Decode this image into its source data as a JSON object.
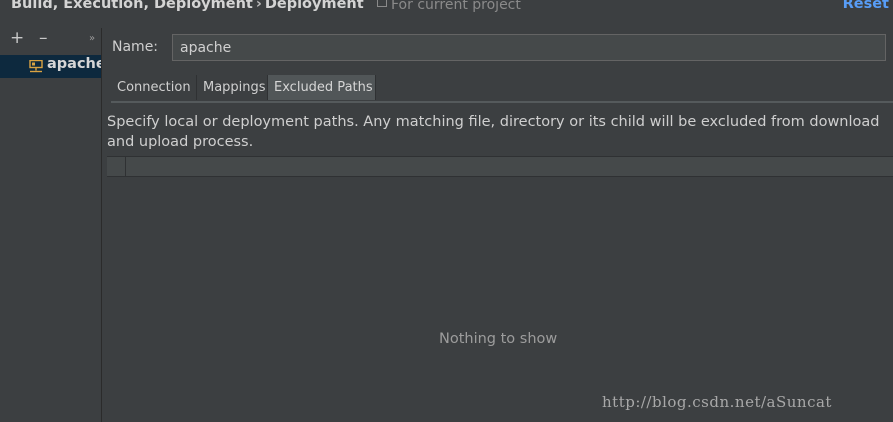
{
  "header": {
    "breadcrumb": [
      "Build, Execution, Deployment",
      "Deployment"
    ],
    "breadcrumb_separator": "›",
    "scope_text": "For current project",
    "reset_label": "Reset"
  },
  "sidebar": {
    "toolbar": {
      "add": "+",
      "remove": "–",
      "more": "»"
    },
    "items": [
      {
        "label": "apache",
        "icon": "server-icon",
        "selected": true
      }
    ]
  },
  "form": {
    "name_label": "Name:",
    "name_value": "apache"
  },
  "tabs": [
    {
      "label": "Connection",
      "active": false
    },
    {
      "label": "Mappings",
      "active": false
    },
    {
      "label": "Excluded Paths",
      "active": true
    }
  ],
  "excluded_paths": {
    "description": "Specify local or deployment paths. Any matching file, directory or its child will be excluded from download and upload process.",
    "empty_text": "Nothing to show"
  },
  "watermark": "http://blog.csdn.net/aSuncat",
  "colors": {
    "background": "#3c3f41",
    "accent": "#589df6",
    "selection": "#0d293e"
  }
}
